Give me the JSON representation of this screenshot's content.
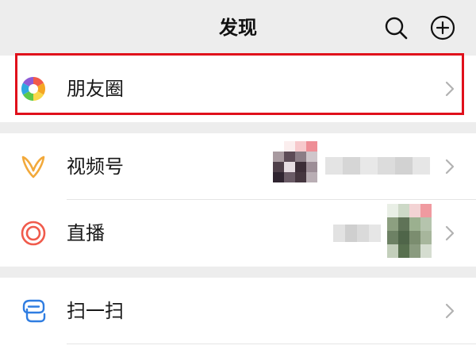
{
  "header": {
    "title": "发现",
    "search_icon": "search-icon",
    "add_icon": "plus-circle-icon"
  },
  "rows": [
    {
      "label": "朋友圈",
      "icon": "moments-aperture-icon"
    },
    {
      "label": "视频号",
      "icon": "channels-butterfly-icon",
      "accent": "#f2a93b"
    },
    {
      "label": "直播",
      "icon": "live-ring-icon",
      "accent": "#f05b4c"
    },
    {
      "label": "扫一扫",
      "icon": "scan-icon",
      "accent": "#2f7de1"
    }
  ],
  "colors": {
    "background": "#ededed",
    "highlight": "#e0101b",
    "chevron": "#b2b2b2"
  }
}
